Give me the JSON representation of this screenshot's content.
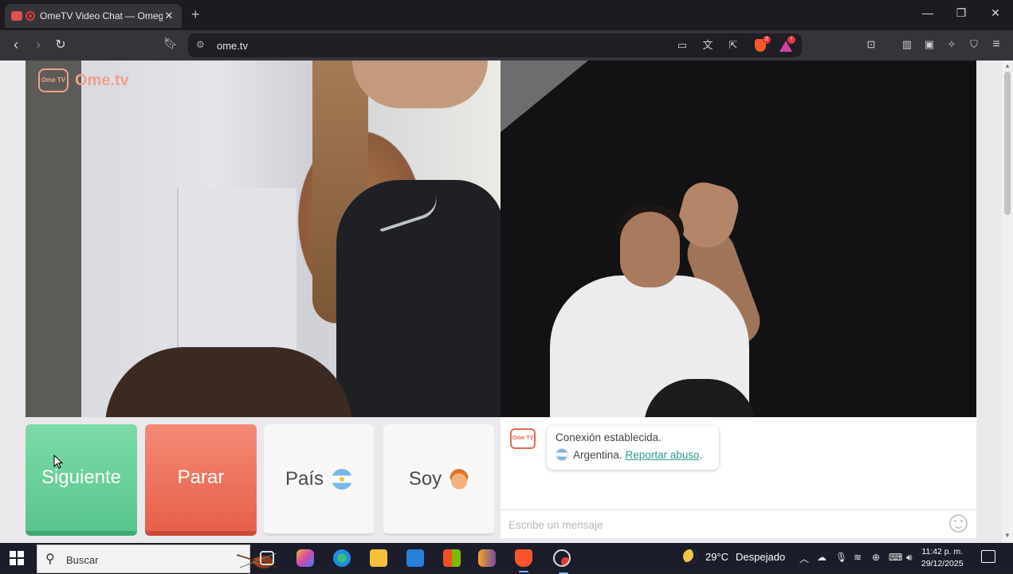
{
  "browser": {
    "tab_title": "OmeTV Video Chat — Omeg",
    "new_tab": "+",
    "url": "ome.tv",
    "shields_count": "2",
    "rewards_count": "!"
  },
  "site": {
    "logo_small": "Ome TV",
    "logo_text": "Ome.tv"
  },
  "controls": {
    "next_label": "Siguiente",
    "stop_label": "Parar",
    "country_label": "País",
    "gender_label": "Soy"
  },
  "chat": {
    "status_line": "Conexión establecida.",
    "country_name": "Argentina.",
    "report_link": "Reportar abuso",
    "report_suffix": ".",
    "input_placeholder": "Escribe un mensaje"
  },
  "taskbar": {
    "search_label": "Buscar",
    "temperature": "29°C",
    "weather_text": "Despejado",
    "time": "11:42 p. m.",
    "date": "29/12/2025"
  },
  "colors": {
    "next_button": "#6dd29a",
    "stop_button": "#ee7560",
    "link": "#2e9a8a",
    "logo": "#f0a08c"
  },
  "icons": [
    "back-icon",
    "forward-icon",
    "reload-icon",
    "bookmark-icon",
    "site-settings-icon",
    "cast-icon",
    "translate-icon",
    "share-icon",
    "brave-shields-icon",
    "brave-rewards-icon",
    "reader-icon",
    "sidebar-icon",
    "wallet-icon",
    "leo-icon",
    "vpn-icon",
    "menu-icon",
    "emoji-icon",
    "windows-start-icon",
    "search-icon"
  ]
}
